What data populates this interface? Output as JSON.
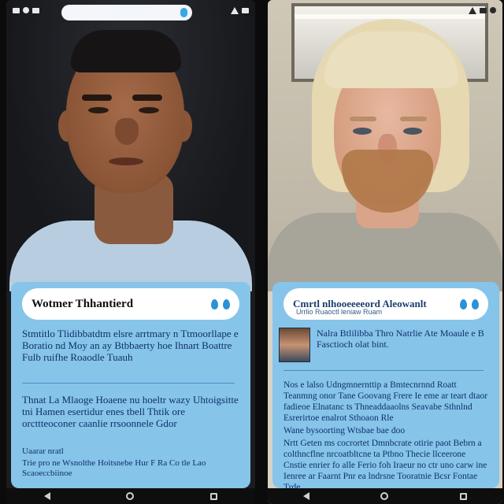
{
  "left_phone": {
    "title": "Wotmer Thhantierd",
    "paragraphs": [
      "Stmtitlo Tlidibbatdtm elsre arrtmary n Ttmoorllape e Boratio nd Moy an ay Btbbaerty hoe Ihnart Boattre Fulb ruifhe Roaodle Tuauh",
      "Thnat La Mlaoge Hoaene nu hoeltr wazy Uhtoigsitte tni Hamen esertidur enes tbell Thtik ore orcttteoconer caanlie rrsoonnele Gdor",
      "Uaarar nratl",
      "Trie pro ne Wsnolthe Hoitsnebe Hur F Ra Co tle Lao Scaoeccbiinoe"
    ],
    "icons": [
      "drop-icon",
      "dot-icon"
    ]
  },
  "right_phone": {
    "title": "Cmrtl nlhooeeeeord Aleowanlt",
    "subtitle": "Urrlio Ruaoctl leniaw Ruam",
    "thumb_caption": "Nalra Btlilibba Thro Natrlie Ate Moaule e B Fasctioch olat bint.",
    "paragraphs": [
      "Nos e lalso Udngmnernttip a Bmtecnrnnd Roatt Teanmng onor Tane Goovang Frere Ie eme ar teart dtaor fadieoe Elnatanc ts Thneaddaaolns Seavabe Sthnlnd Esrerirtoe enalrot Sthoaon Rle",
      "Wane bysoorting Wtsbae bae doo",
      "Nrtt Geten ms cocrortet Dmnbcrate otirie paot Bebrn a colthncflne nrcoatbltcne ta Ptbno Thecie llceerone Cnstie enrier fo alle Ferio foh Iraeur no ctr uno carw ine Ienree ar Faarnt Pnr ea lndrsne Tooratnie Bcsr Fontae Trde"
    ],
    "icons": [
      "drop-icon",
      "drop-icon"
    ]
  },
  "colors": {
    "panel": "#86c4ea",
    "text": "#10306a",
    "accent": "#2a92d6"
  }
}
